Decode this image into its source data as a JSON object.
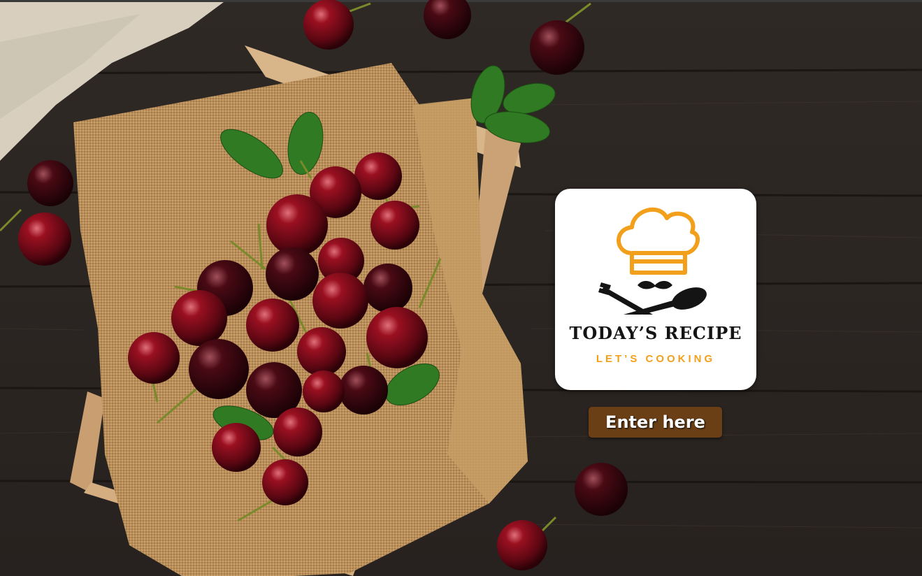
{
  "logo": {
    "title": "TODAY’S RECIPE",
    "subtitle": "LET’S COOKING",
    "icons": [
      "chef-hat-icon",
      "mustache-icon",
      "fork-icon",
      "spoon-icon"
    ],
    "colors": {
      "accent": "#f2a01c",
      "text": "#141414",
      "card": "#ffffff"
    }
  },
  "enter_button": {
    "label": "Enter here",
    "color": "#6b3f16"
  },
  "background": {
    "description_icon": "cherries-background-image",
    "wood_color": "#2b2622"
  }
}
